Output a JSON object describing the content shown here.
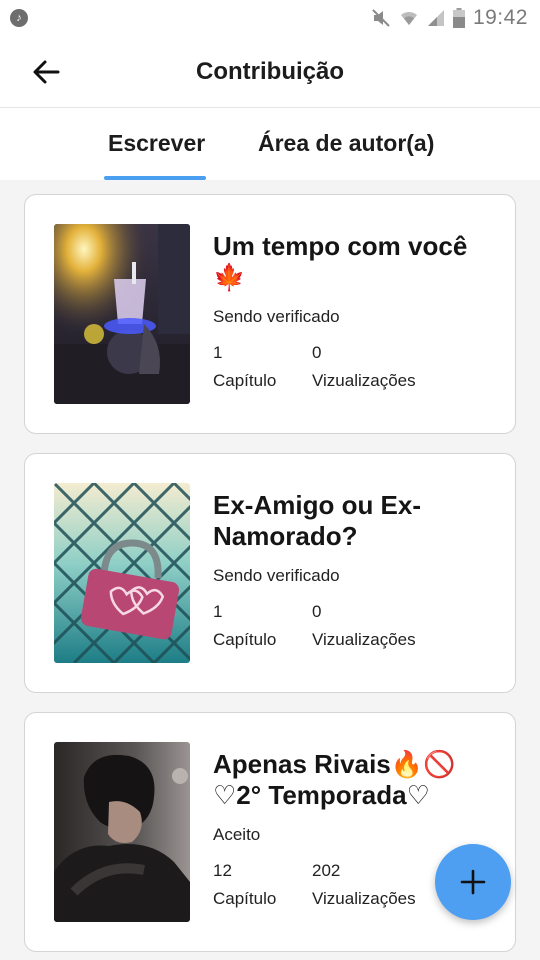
{
  "status_bar": {
    "time": "19:42",
    "icons": [
      "music-notification-icon",
      "mute-icon",
      "wifi-icon",
      "signal-icon",
      "battery-icon"
    ]
  },
  "app_bar": {
    "title": "Contribuição",
    "back_icon": "arrow-back-icon"
  },
  "tabs": [
    {
      "label": "Escrever",
      "selected": true
    },
    {
      "label": "Área de autor(a)",
      "selected": false
    }
  ],
  "stories": [
    {
      "title": "Um tempo com você 🍁",
      "status": "Sendo verificado",
      "chapters": "1",
      "chapters_label": "Capítulo",
      "views": "0",
      "views_label": "Vizualizações"
    },
    {
      "title": "Ex-Amigo ou Ex-Namorado?",
      "status": "Sendo verificado",
      "chapters": "1",
      "chapters_label": "Capítulo",
      "views": "0",
      "views_label": "Vizualizações"
    },
    {
      "title": "Apenas Rivais🔥🚫♡2° Temporada♡",
      "status": "Aceito",
      "chapters": "12",
      "chapters_label": "Capítulo",
      "views": "202",
      "views_label": "Vizualizações"
    }
  ],
  "fab": {
    "icon": "plus-icon"
  },
  "colors": {
    "accent": "#4a9ff0",
    "fab": "#4e9ef2",
    "background": "#f4f4f4",
    "card_border": "#d4d4d4"
  }
}
